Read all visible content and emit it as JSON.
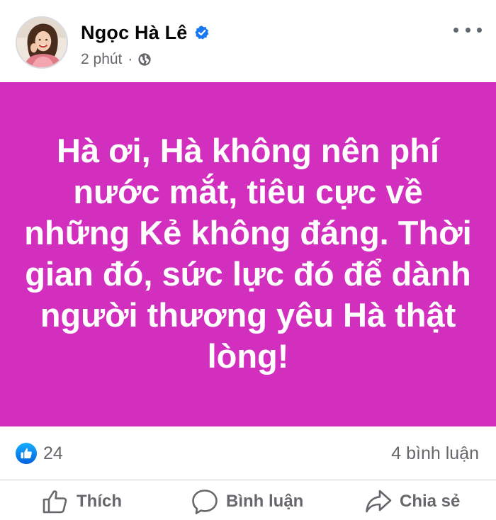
{
  "post": {
    "author": "Ngọc Hà Lê",
    "timestamp": "2 phút",
    "separator": "·",
    "privacy_icon": "globe-icon",
    "verified_icon": "verified-badge-icon",
    "more_icon": "more-options-icon",
    "background_color": "#d32fbf",
    "text": "Hà ơi, Hà không nên phí nước mắt, tiêu cực về những Kẻ không đáng. Thời gian đó, sức lực đó để dành người thương yêu Hà thật lòng!"
  },
  "reactions": {
    "icon": "like-reaction-icon",
    "count": "24",
    "comments": "4 bình luận"
  },
  "actions": {
    "like_label": "Thích",
    "comment_label": "Bình luận",
    "share_label": "Chia sẻ"
  },
  "colors": {
    "accent": "#1877f2",
    "secondary_text": "#65676b"
  }
}
